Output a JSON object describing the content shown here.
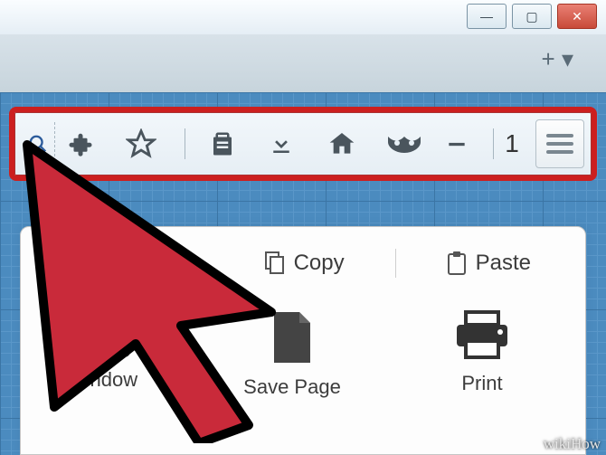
{
  "watermark": "wikiHow",
  "window_controls": {
    "minimize_glyph": "—",
    "maximize_glyph": "▢",
    "close_glyph": "✕"
  },
  "tab_strip": {
    "new_tab_glyph": "+ ▾"
  },
  "toolbar": {
    "highlighted": true,
    "icons": {
      "search": "search-icon",
      "addons": "puzzle-icon",
      "bookmark": "star-icon",
      "list": "clipboard-icon",
      "downloads": "download-icon",
      "home": "home-icon",
      "private": "mask-icon",
      "minimize_tool": "minus-icon"
    },
    "page_count": "1",
    "menu_button": "menu-icon"
  },
  "menu_panel": {
    "row1": [
      {
        "icon": "copy-icon",
        "label": "Copy"
      },
      {
        "icon": "paste-icon",
        "label": "Paste"
      }
    ],
    "row2": [
      {
        "icon": "window-icon",
        "label": "Window"
      },
      {
        "icon": "save-icon",
        "label": "Save Page"
      },
      {
        "icon": "print-icon",
        "label": "Print"
      }
    ]
  },
  "cursor_overlay": {
    "name": "large-red-arrow",
    "color": "#c92a3a",
    "outline": "#000000"
  }
}
